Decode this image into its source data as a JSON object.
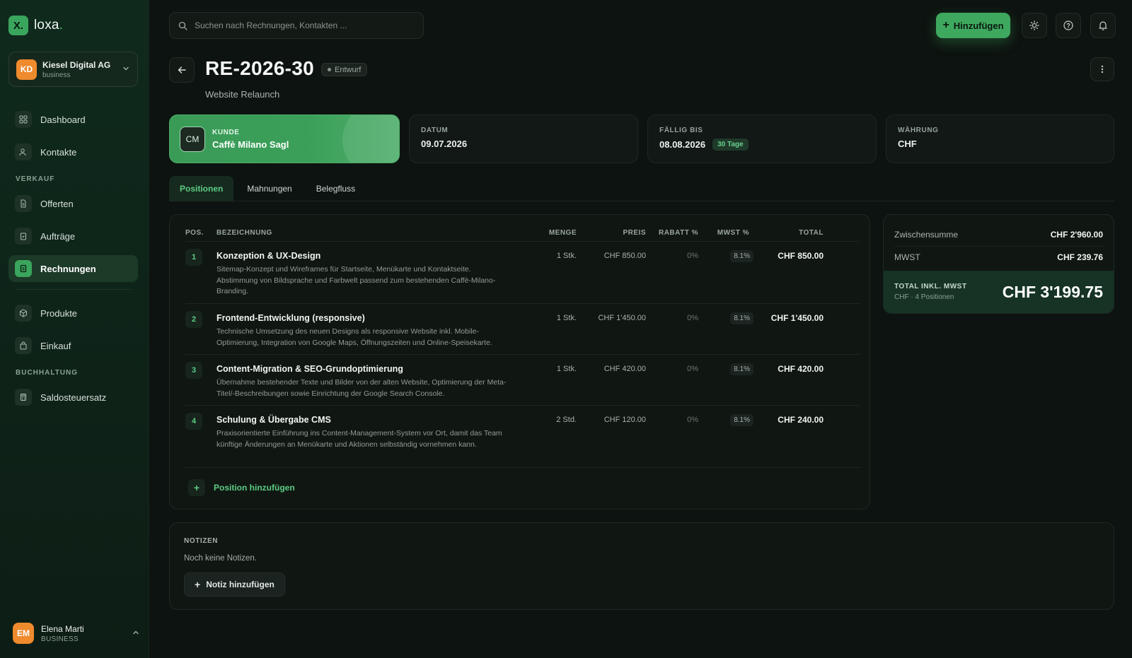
{
  "brand": {
    "logo_mark": "X.",
    "name": "loxa",
    "accent": "#3ea85f"
  },
  "org": {
    "initials": "KD",
    "name": "Kiesel Digital AG",
    "type": "business"
  },
  "sidebar": {
    "items_top": [
      {
        "label": "Dashboard",
        "icon": "dashboard-icon"
      },
      {
        "label": "Kontakte",
        "icon": "contacts-icon"
      }
    ],
    "section_sales": "VERKAUF",
    "items_sales": [
      {
        "label": "Offerten",
        "icon": "document-icon"
      },
      {
        "label": "Aufträge",
        "icon": "clipboard-icon"
      },
      {
        "label": "Rechnungen",
        "icon": "invoice-icon",
        "active": true
      }
    ],
    "items_more": [
      {
        "label": "Produkte",
        "icon": "package-icon"
      },
      {
        "label": "Einkauf",
        "icon": "shopping-bag-icon"
      }
    ],
    "section_accounting": "BUCHHALTUNG",
    "items_accounting": [
      {
        "label": "Saldosteuersatz",
        "icon": "calculator-icon"
      }
    ]
  },
  "user": {
    "initials": "EM",
    "name": "Elena Marti",
    "role": "BUSINESS"
  },
  "search": {
    "placeholder": "Suchen nach Rechnungen, Kontakten ..."
  },
  "topbar": {
    "add_label": "Hinzufügen"
  },
  "invoice": {
    "number": "RE-2026-30",
    "status": "Entwurf",
    "subtitle": "Website Relaunch"
  },
  "cards": {
    "customer": {
      "label": "KUNDE",
      "initials": "CM",
      "value": "Caffè Milano Sagl"
    },
    "date": {
      "label": "DATUM",
      "value": "09.07.2026"
    },
    "due": {
      "label": "FÄLLIG BIS",
      "value": "08.08.2026",
      "badge": "30 Tage"
    },
    "currency": {
      "label": "WÄHRUNG",
      "value": "CHF"
    }
  },
  "tabs": [
    "Positionen",
    "Mahnungen",
    "Belegfluss"
  ],
  "table": {
    "headers": {
      "pos": "POS.",
      "name": "BEZEICHNUNG",
      "qty": "MENGE",
      "price": "PREIS",
      "discount": "RABATT %",
      "tax": "MWST %",
      "total": "TOTAL"
    },
    "rows": [
      {
        "pos": "1",
        "name": "Konzeption & UX-Design",
        "desc": "Sitemap-Konzept und Wireframes für Startseite, Menükarte und Kontaktseite. Abstimmung von Bildsprache und Farbwelt passend zum bestehenden Caffè-Milano-Branding.",
        "qty": "1 Stk.",
        "price": "CHF 850.00",
        "discount": "0%",
        "tax": "8.1%",
        "total": "CHF 850.00"
      },
      {
        "pos": "2",
        "name": "Frontend-Entwicklung (responsive)",
        "desc": "Technische Umsetzung des neuen Designs als responsive Website inkl. Mobile-Optimierung, Integration von Google Maps, Öffnungszeiten und Online-Speisekarte.",
        "qty": "1 Stk.",
        "price": "CHF 1'450.00",
        "discount": "0%",
        "tax": "8.1%",
        "total": "CHF 1'450.00"
      },
      {
        "pos": "3",
        "name": "Content-Migration & SEO-Grundoptimierung",
        "desc": "Übernahme bestehender Texte und Bilder von der alten Website, Optimierung der Meta-Titel/-Beschreibungen sowie Einrichtung der Google Search Console.",
        "qty": "1 Stk.",
        "price": "CHF 420.00",
        "discount": "0%",
        "tax": "8.1%",
        "total": "CHF 420.00"
      },
      {
        "pos": "4",
        "name": "Schulung & Übergabe CMS",
        "desc": "Praxisorientierte Einführung ins Content-Management-System vor Ort, damit das Team künftige Änderungen an Menükarte und Aktionen selbständig vornehmen kann.",
        "qty": "2 Std.",
        "price": "CHF 120.00",
        "discount": "0%",
        "tax": "8.1%",
        "total": "CHF 240.00"
      }
    ],
    "add_label": "Position hinzufügen"
  },
  "summary": {
    "subtotal_label": "Zwischensumme",
    "subtotal": "CHF 2'960.00",
    "tax_label": "MWST",
    "tax": "CHF 239.76",
    "total_label": "TOTAL INKL. MWST",
    "total_sub": "CHF · 4 Positionen",
    "total": "CHF 3'199.75"
  },
  "notes": {
    "label": "NOTIZEN",
    "empty": "Noch keine Notizen.",
    "add_label": "Notiz hinzufügen"
  }
}
